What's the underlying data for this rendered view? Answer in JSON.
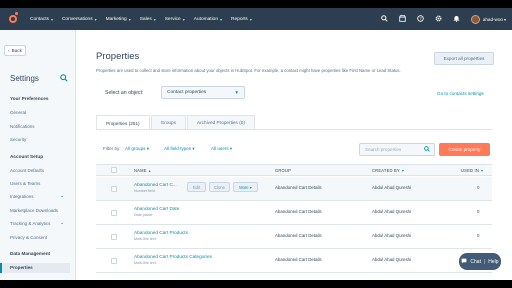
{
  "topnav": {
    "items": [
      {
        "label": "Contacts"
      },
      {
        "label": "Conversations"
      },
      {
        "label": "Marketing"
      },
      {
        "label": "Sales"
      },
      {
        "label": "Service"
      },
      {
        "label": "Automation"
      },
      {
        "label": "Reports"
      }
    ],
    "chevron": "▾",
    "user_name": "ahad-woo",
    "icons": [
      "search-icon",
      "marketplace-icon",
      "help-icon",
      "settings-icon",
      "notifications-icon"
    ],
    "accent": "#ff7a59",
    "bar_color": "#2d3e50"
  },
  "sidebar": {
    "back_label": "Back",
    "title": "Settings",
    "search_glyph": "⌕",
    "sections": [
      {
        "heading": "Your Preferences",
        "items": [
          "General",
          "Notifications",
          "Security"
        ]
      },
      {
        "heading": "Account Setup",
        "items": [
          "Account Defaults",
          "Users & Teams",
          "Integrations",
          "Marketplace Downloads",
          "Tracking & Analytics",
          "Privacy & Consent"
        ]
      },
      {
        "heading": "Data Management",
        "items": [
          "Properties"
        ]
      }
    ],
    "active_item": "Properties"
  },
  "main": {
    "title": "Properties",
    "export_label": "Export all properties",
    "description": "Properties are used to collect and store information about your objects in HubSpot. For example, a contact might have properties like First Name or Lead Status.",
    "select_label": "Select an object:",
    "select_value": "Contact properties",
    "contacts_link": "Go to contacts settings",
    "tabs": [
      {
        "label": "Properties (251)"
      },
      {
        "label": "Groups"
      },
      {
        "label": "Archived Properties (0)"
      }
    ],
    "filter_label": "Filter by:",
    "filters": [
      {
        "label": "All groups ▾"
      },
      {
        "label": "All field types ▾"
      },
      {
        "label": "All users ▾"
      }
    ],
    "search_placeholder": "Search properties",
    "create_label": "Create property",
    "columns": {
      "name": "NAME",
      "group": "GROUP",
      "created_by": "CREATED BY",
      "used_in": "USED IN"
    },
    "sort_glyph": "▴",
    "row_actions": {
      "edit": "Edit",
      "clone": "Clone",
      "more": "More ▾"
    },
    "rows": [
      {
        "name": "Abandoned Cart C...",
        "type": "Number field",
        "group": "Abandoned Cart Details",
        "created_by": "Abdul Ahad Qureshi",
        "used_in": "0"
      },
      {
        "name": "Abandoned Cart Date",
        "type": "Date picker",
        "group": "Abandoned Cart Details",
        "created_by": "Abdul Ahad Qureshi",
        "used_in": "0"
      },
      {
        "name": "Abandoned Cart Products",
        "type": "Multi-line text",
        "group": "Abandoned Cart Details",
        "created_by": "Abdul Ahad Qureshi",
        "used_in": "0"
      },
      {
        "name": "Abandoned Cart Products Categories",
        "type": "Multi-line text",
        "group": "Abandoned Cart Details",
        "created_by": "Abdul Ahad Qureshi",
        "used_in": "0"
      }
    ]
  },
  "chat": {
    "chat_label": "Chat",
    "help_label": "Help"
  }
}
